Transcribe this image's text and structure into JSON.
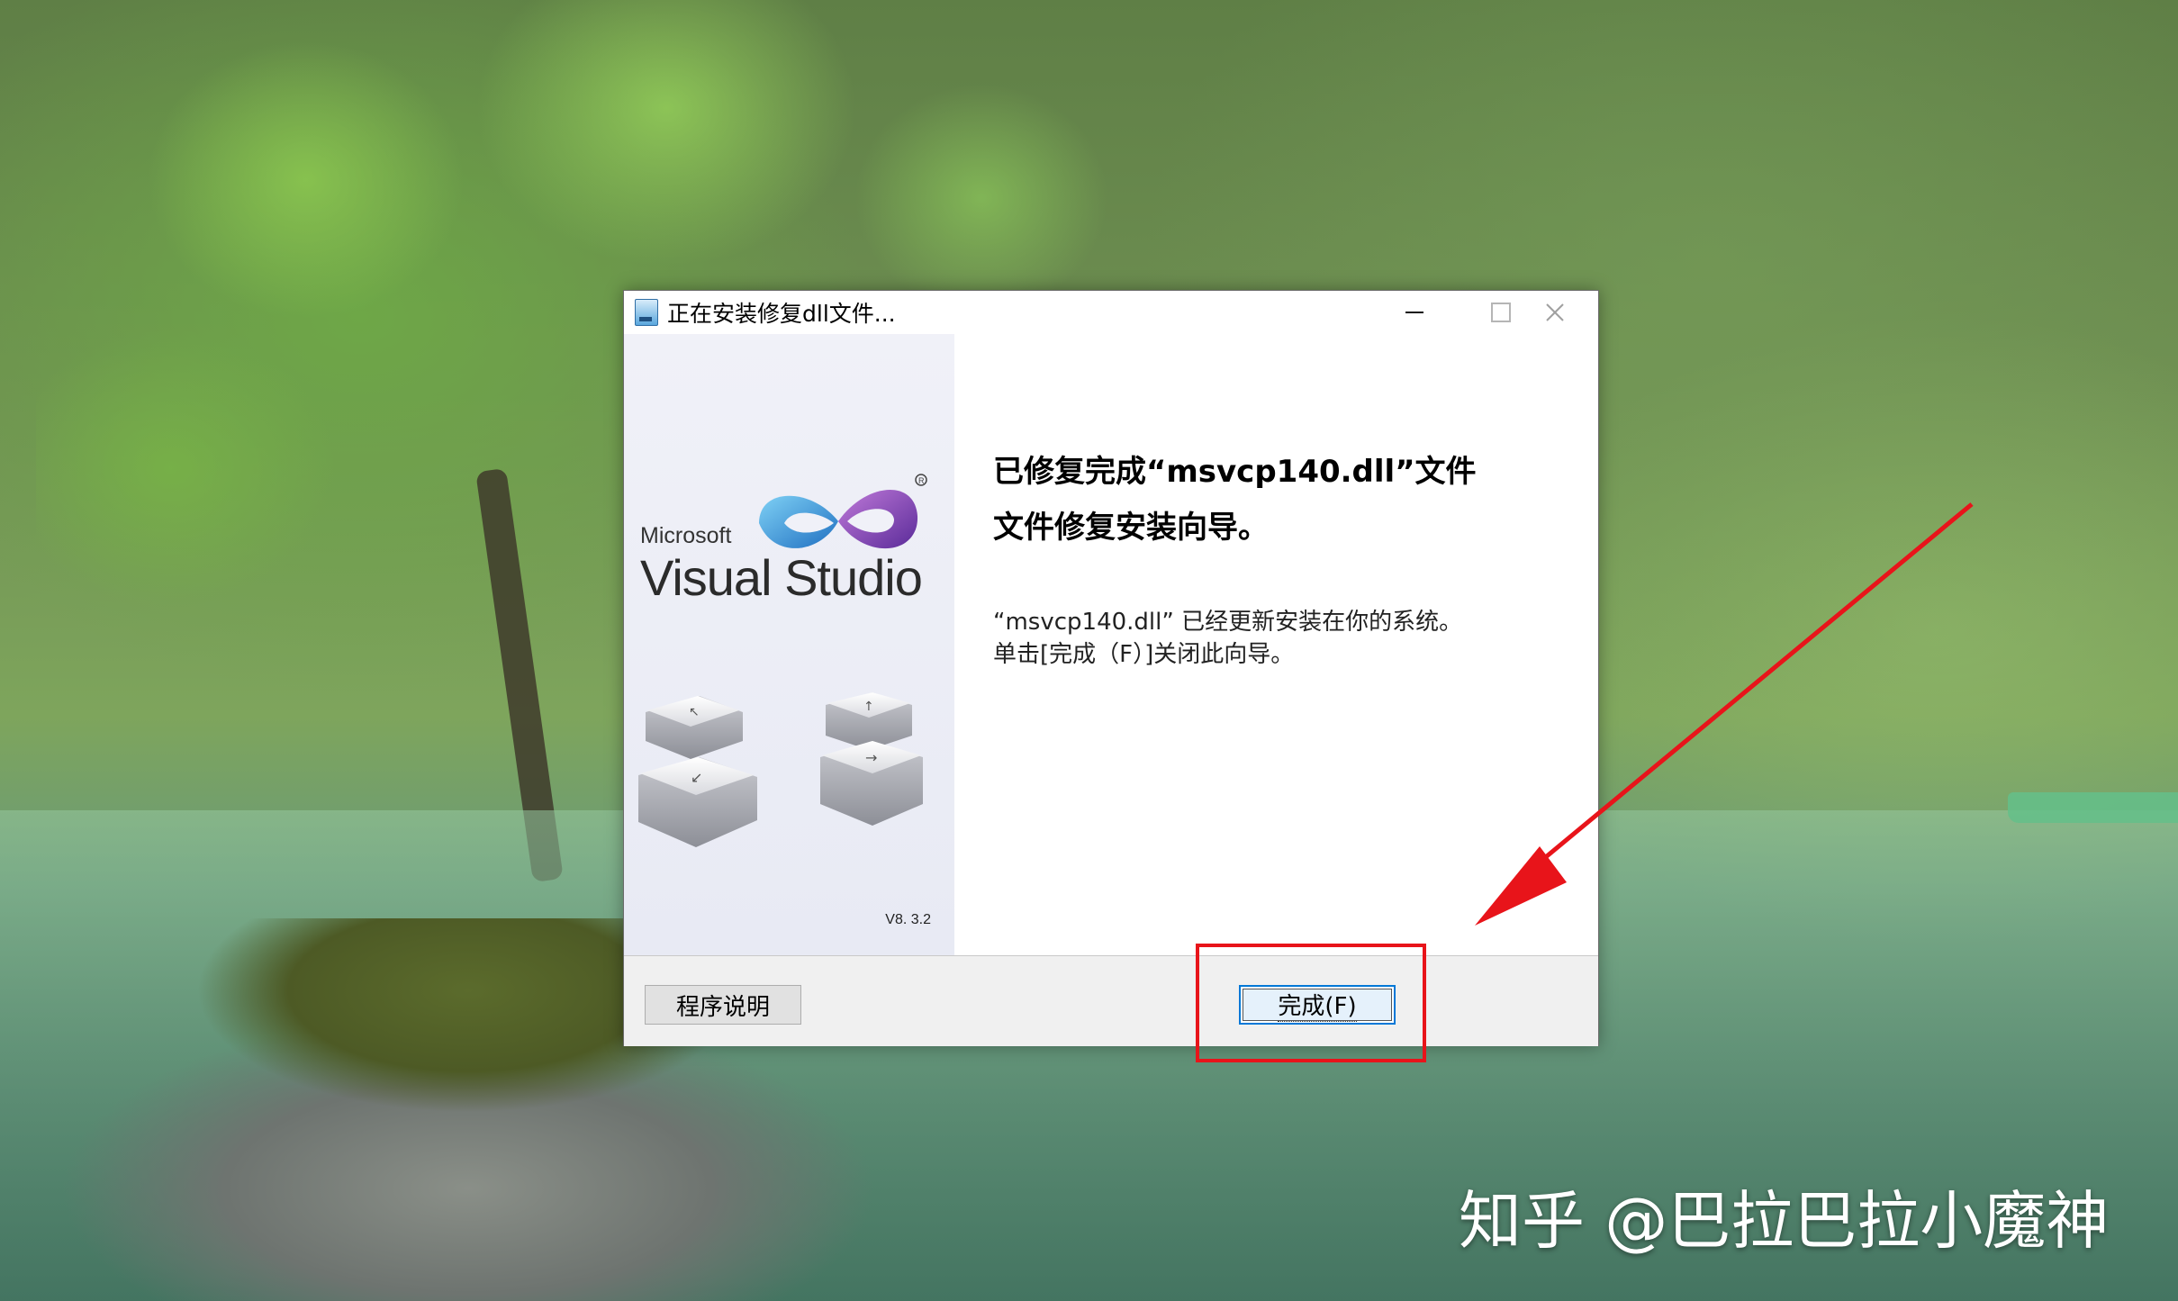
{
  "window": {
    "title": "正在安装修复dll文件...",
    "icon": "installer-icon",
    "controls": {
      "minimize": "minimize-icon",
      "maximize": "maximize-icon",
      "close": "close-icon"
    }
  },
  "side_panel": {
    "brand_small": "Microsoft",
    "brand_large": "Visual Studio",
    "version": "V8. 3.2",
    "logo": "visual-studio-infinity-logo",
    "graphic": "keyboard-arrow-keys"
  },
  "content": {
    "heading_line1": "已修复完成“msvcp140.dll”文件",
    "heading_line2": "文件修复安装向导。",
    "message_line1": "“msvcp140.dll” 已经更新安装在你的系统。",
    "message_line2": "单击[完成（F）]关闭此向导。"
  },
  "buttons": {
    "help_label": "程序说明",
    "finish_label": "完成(F)"
  },
  "annotation": {
    "highlight_color": "#e8141a",
    "watermark": "知乎 @巴拉巴拉小魔神"
  },
  "colors": {
    "accent": "#0078d7",
    "panel_bg": "#f0f0f0"
  }
}
